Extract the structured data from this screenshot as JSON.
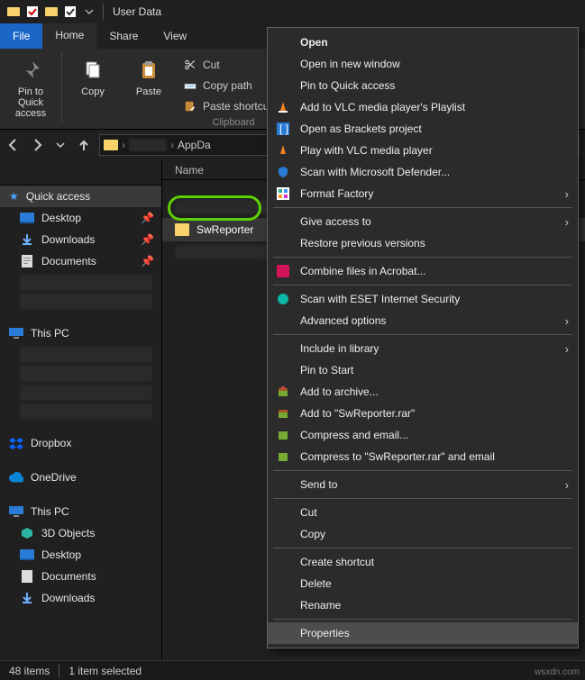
{
  "window": {
    "title": "User Data"
  },
  "tabs": {
    "file": "File",
    "home": "Home",
    "share": "Share",
    "view": "View"
  },
  "ribbon": {
    "pin": "Pin to Quick\naccess",
    "copy": "Copy",
    "paste": "Paste",
    "cut": "Cut",
    "copy_path": "Copy path",
    "paste_shortcut": "Paste shortcut",
    "clipboard_group": "Clipboard"
  },
  "breadcrumb": {
    "seg0": "AppDa"
  },
  "columns": {
    "name": "Name"
  },
  "sidebar": {
    "quick_access": "Quick access",
    "items": [
      {
        "label": "Desktop"
      },
      {
        "label": "Downloads"
      },
      {
        "label": "Documents"
      }
    ],
    "this_pc_top": "This PC",
    "dropbox": "Dropbox",
    "onedrive": "OneDrive",
    "this_pc": "This PC",
    "pc_items": [
      {
        "label": "3D Objects"
      },
      {
        "label": "Desktop"
      },
      {
        "label": "Documents"
      },
      {
        "label": "Downloads"
      }
    ]
  },
  "list": {
    "rows": [
      {
        "label": "SwReporter"
      }
    ]
  },
  "context_menu": {
    "open": "Open",
    "open_new_window": "Open in new window",
    "pin_quick": "Pin to Quick access",
    "vlc_playlist": "Add to VLC media player's Playlist",
    "brackets": "Open as Brackets project",
    "vlc_play": "Play with VLC media player",
    "defender": "Scan with Microsoft Defender...",
    "format_factory": "Format Factory",
    "give_access": "Give access to",
    "restore": "Restore previous versions",
    "acrobat": "Combine files in Acrobat...",
    "eset": "Scan with ESET Internet Security",
    "advanced": "Advanced options",
    "include_lib": "Include in library",
    "pin_start": "Pin to Start",
    "add_archive": "Add to archive...",
    "add_rar": "Add to \"SwReporter.rar\"",
    "compress_email": "Compress and email...",
    "compress_rar_email": "Compress to \"SwReporter.rar\" and email",
    "send_to": "Send to",
    "cut": "Cut",
    "copy": "Copy",
    "create_shortcut": "Create shortcut",
    "delete": "Delete",
    "rename": "Rename",
    "properties": "Properties"
  },
  "status": {
    "count": "48 items",
    "selected": "1 item selected"
  },
  "watermark": "wsxdn.com"
}
